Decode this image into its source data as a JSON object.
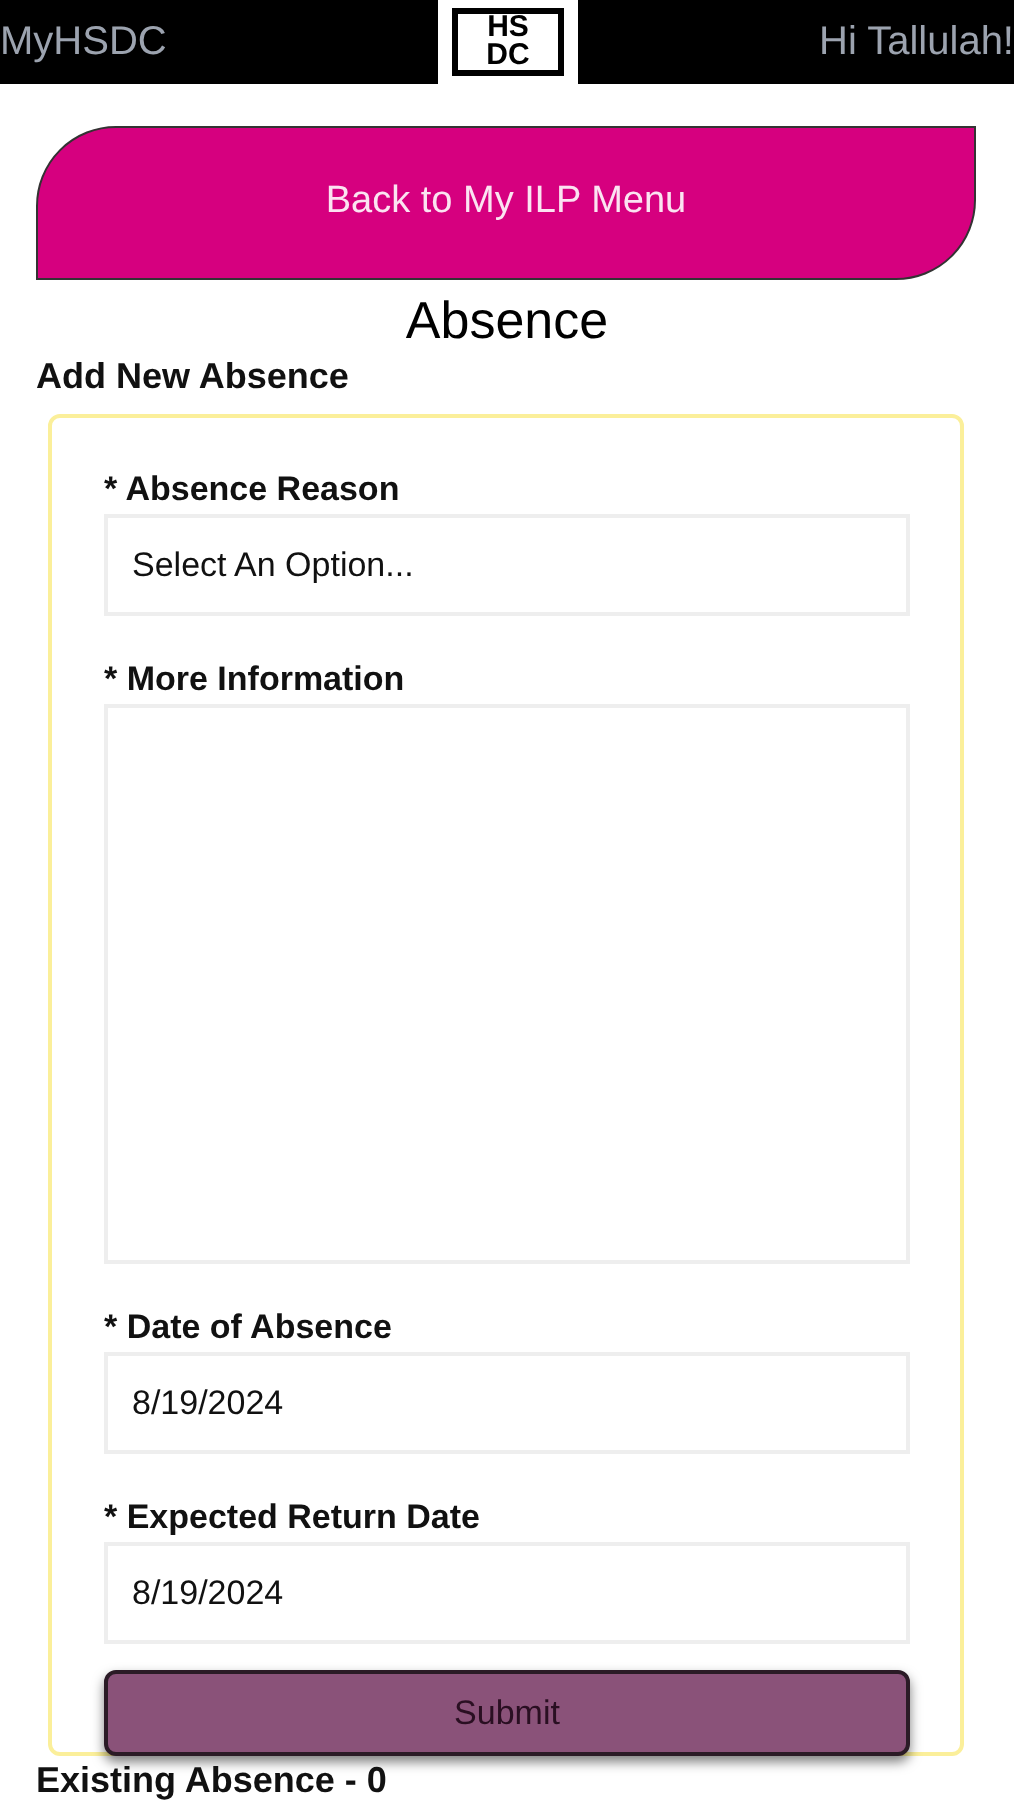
{
  "header": {
    "app_name": "MyHSDC",
    "logo_lines": [
      "HS",
      "DC"
    ],
    "greeting": "Hi Tallulah!"
  },
  "back_button": "Back to My ILP Menu",
  "title": "Absence",
  "form": {
    "heading": "Add New Absence",
    "fields": [
      {
        "kind": "select",
        "label": "* Absence Reason",
        "value": "Select An Option..."
      },
      {
        "kind": "textarea",
        "label": "* More Information"
      },
      {
        "kind": "input",
        "label": "* Date of Absence",
        "value": "8/19/2024"
      },
      {
        "kind": "input",
        "label": "* Expected Return Date",
        "value": "8/19/2024"
      }
    ],
    "submit": "Submit"
  },
  "existing_heading": "Existing Absence - 0"
}
